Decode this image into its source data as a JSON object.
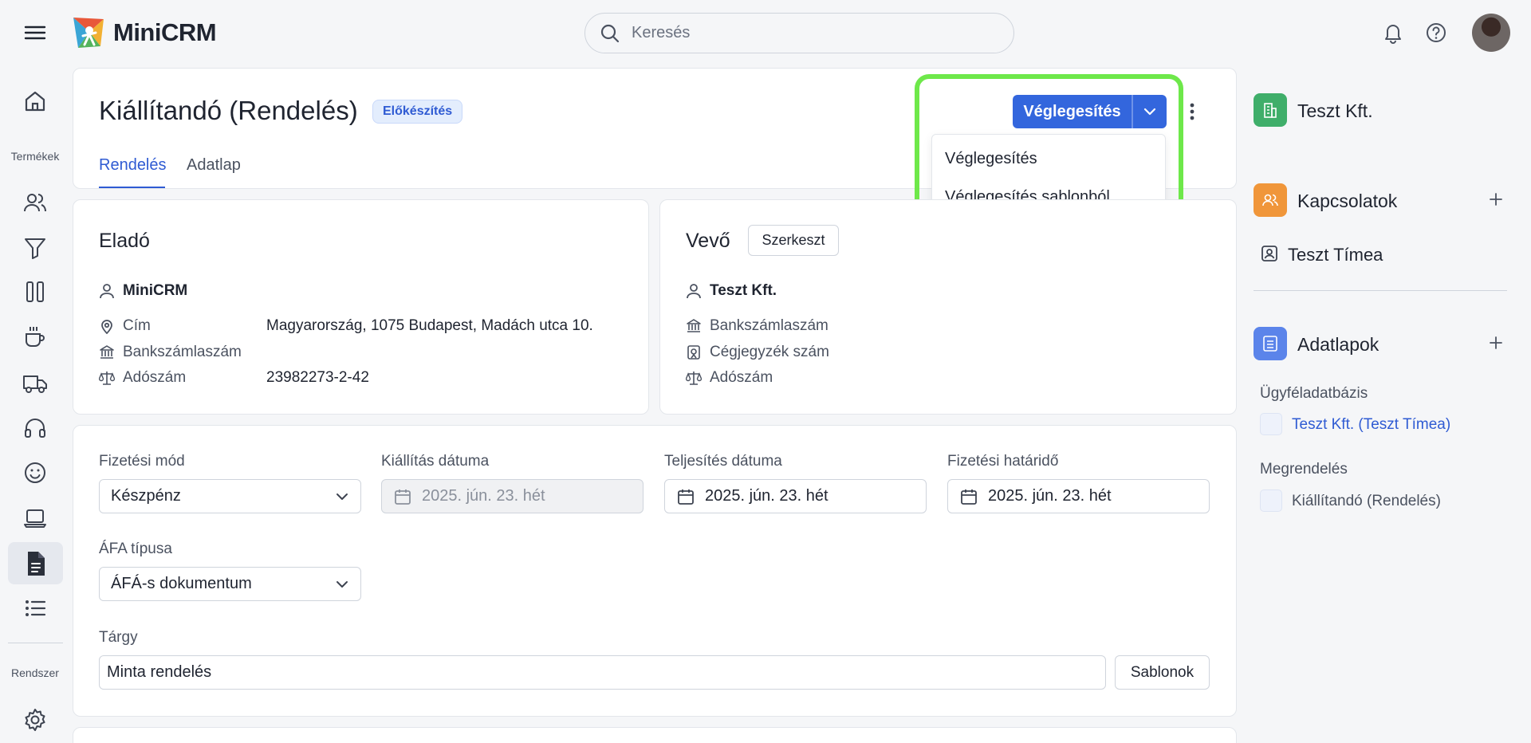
{
  "app": {
    "name": "MiniCRM"
  },
  "search": {
    "placeholder": "Keresés"
  },
  "sidebar": {
    "section_products": "Termékek",
    "section_system": "Rendszer"
  },
  "page": {
    "title": "Kiállítandó (Rendelés)",
    "status_badge": "Előkészítés",
    "tabs": [
      {
        "label": "Rendelés"
      },
      {
        "label": "Adatlap"
      }
    ]
  },
  "actions": {
    "primary_label": "Véglegesítés",
    "dropdown_items": [
      {
        "label": "Véglegesítés"
      },
      {
        "label": "Véglegesítés sablonból"
      }
    ]
  },
  "seller": {
    "heading": "Eladó",
    "name": "MiniCRM",
    "address_label": "Cím",
    "address_value": "Magyarország, 1075 Budapest, Madách utca 10.",
    "bank_label": "Bankszámlaszám",
    "tax_label": "Adószám",
    "tax_value": "23982273-2-42"
  },
  "buyer": {
    "heading": "Vevő",
    "edit_label": "Szerkeszt",
    "name": "Teszt Kft.",
    "bank_label": "Bankszámlaszám",
    "registry_label": "Cégjegyzék szám",
    "tax_label": "Adószám"
  },
  "form": {
    "payment_method": {
      "label": "Fizetési mód",
      "value": "Készpénz"
    },
    "issue_date": {
      "label": "Kiállítás dátuma",
      "value": "2025. jún. 23. hét"
    },
    "fulfillment_date": {
      "label": "Teljesítés dátuma",
      "value": "2025. jún. 23. hét"
    },
    "payment_deadline": {
      "label": "Fizetési határidő",
      "value": "2025. jún. 23. hét"
    },
    "vat_type": {
      "label": "ÁFA típusa",
      "value": "ÁFÁ-s dokumentum"
    },
    "subject": {
      "label": "Tárgy",
      "value": "Minta rendelés"
    },
    "templates_label": "Sablonok"
  },
  "right_panel": {
    "company": "Teszt Kft.",
    "contacts_title": "Kapcsolatok",
    "contact_name": "Teszt Tímea",
    "datasheets_title": "Adatlapok",
    "group1_title": "Ügyféladatbázis",
    "group1_item": "Teszt Kft. (Teszt Tímea)",
    "group2_title": "Megrendelés",
    "group2_item": "Kiállítandó (Rendelés)"
  },
  "colors": {
    "accent": "#3366dd",
    "highlight": "#6ee84a",
    "company_icon": "#3fae6a",
    "contacts_icon": "#f0963a",
    "datasheets_icon": "#5b84ea"
  }
}
